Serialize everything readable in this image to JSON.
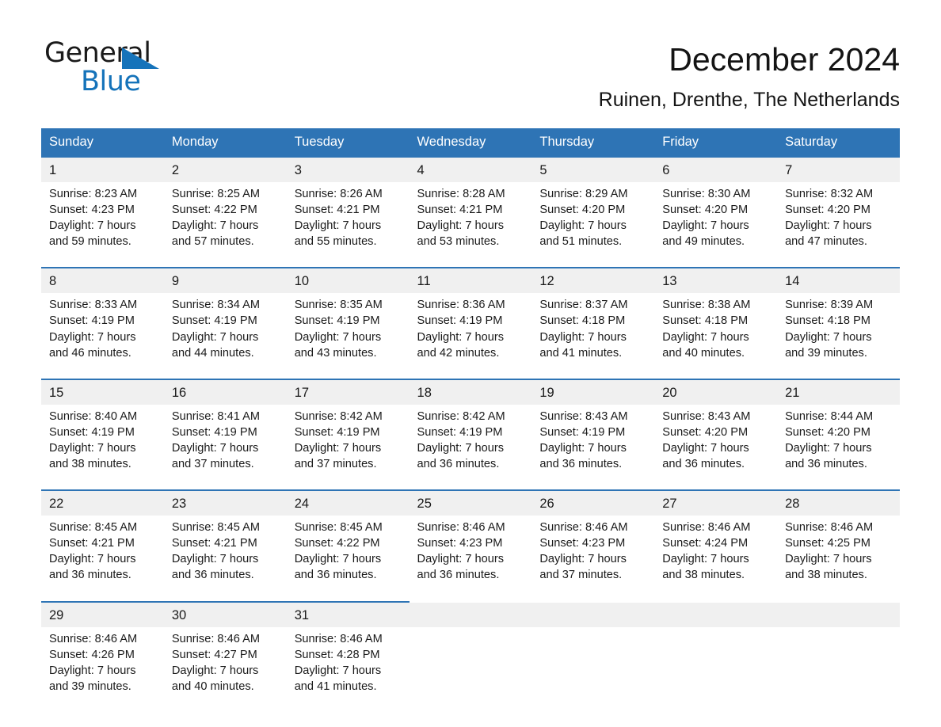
{
  "logo": {
    "word1": "General",
    "word2": "Blue",
    "accent_color": "#1573ba",
    "triangle_icon": "triangle-icon"
  },
  "header": {
    "title": "December 2024",
    "subtitle": "Ruinen, Drenthe, The Netherlands"
  },
  "colors": {
    "header_blue": "#2e74b5",
    "daynum_gray": "#f0f0f0",
    "text": "#1a1a1a",
    "header_text": "#ffffff"
  },
  "weekday_headers": [
    "Sunday",
    "Monday",
    "Tuesday",
    "Wednesday",
    "Thursday",
    "Friday",
    "Saturday"
  ],
  "labels": {
    "sunrise_prefix": "Sunrise:",
    "sunset_prefix": "Sunset:",
    "daylight_prefix": "Daylight:"
  },
  "weeks": [
    [
      {
        "day": "1",
        "sunrise": "Sunrise: 8:23 AM",
        "sunset": "Sunset: 4:23 PM",
        "daylight1": "Daylight: 7 hours",
        "daylight2": "and 59 minutes."
      },
      {
        "day": "2",
        "sunrise": "Sunrise: 8:25 AM",
        "sunset": "Sunset: 4:22 PM",
        "daylight1": "Daylight: 7 hours",
        "daylight2": "and 57 minutes."
      },
      {
        "day": "3",
        "sunrise": "Sunrise: 8:26 AM",
        "sunset": "Sunset: 4:21 PM",
        "daylight1": "Daylight: 7 hours",
        "daylight2": "and 55 minutes."
      },
      {
        "day": "4",
        "sunrise": "Sunrise: 8:28 AM",
        "sunset": "Sunset: 4:21 PM",
        "daylight1": "Daylight: 7 hours",
        "daylight2": "and 53 minutes."
      },
      {
        "day": "5",
        "sunrise": "Sunrise: 8:29 AM",
        "sunset": "Sunset: 4:20 PM",
        "daylight1": "Daylight: 7 hours",
        "daylight2": "and 51 minutes."
      },
      {
        "day": "6",
        "sunrise": "Sunrise: 8:30 AM",
        "sunset": "Sunset: 4:20 PM",
        "daylight1": "Daylight: 7 hours",
        "daylight2": "and 49 minutes."
      },
      {
        "day": "7",
        "sunrise": "Sunrise: 8:32 AM",
        "sunset": "Sunset: 4:20 PM",
        "daylight1": "Daylight: 7 hours",
        "daylight2": "and 47 minutes."
      }
    ],
    [
      {
        "day": "8",
        "sunrise": "Sunrise: 8:33 AM",
        "sunset": "Sunset: 4:19 PM",
        "daylight1": "Daylight: 7 hours",
        "daylight2": "and 46 minutes."
      },
      {
        "day": "9",
        "sunrise": "Sunrise: 8:34 AM",
        "sunset": "Sunset: 4:19 PM",
        "daylight1": "Daylight: 7 hours",
        "daylight2": "and 44 minutes."
      },
      {
        "day": "10",
        "sunrise": "Sunrise: 8:35 AM",
        "sunset": "Sunset: 4:19 PM",
        "daylight1": "Daylight: 7 hours",
        "daylight2": "and 43 minutes."
      },
      {
        "day": "11",
        "sunrise": "Sunrise: 8:36 AM",
        "sunset": "Sunset: 4:19 PM",
        "daylight1": "Daylight: 7 hours",
        "daylight2": "and 42 minutes."
      },
      {
        "day": "12",
        "sunrise": "Sunrise: 8:37 AM",
        "sunset": "Sunset: 4:18 PM",
        "daylight1": "Daylight: 7 hours",
        "daylight2": "and 41 minutes."
      },
      {
        "day": "13",
        "sunrise": "Sunrise: 8:38 AM",
        "sunset": "Sunset: 4:18 PM",
        "daylight1": "Daylight: 7 hours",
        "daylight2": "and 40 minutes."
      },
      {
        "day": "14",
        "sunrise": "Sunrise: 8:39 AM",
        "sunset": "Sunset: 4:18 PM",
        "daylight1": "Daylight: 7 hours",
        "daylight2": "and 39 minutes."
      }
    ],
    [
      {
        "day": "15",
        "sunrise": "Sunrise: 8:40 AM",
        "sunset": "Sunset: 4:19 PM",
        "daylight1": "Daylight: 7 hours",
        "daylight2": "and 38 minutes."
      },
      {
        "day": "16",
        "sunrise": "Sunrise: 8:41 AM",
        "sunset": "Sunset: 4:19 PM",
        "daylight1": "Daylight: 7 hours",
        "daylight2": "and 37 minutes."
      },
      {
        "day": "17",
        "sunrise": "Sunrise: 8:42 AM",
        "sunset": "Sunset: 4:19 PM",
        "daylight1": "Daylight: 7 hours",
        "daylight2": "and 37 minutes."
      },
      {
        "day": "18",
        "sunrise": "Sunrise: 8:42 AM",
        "sunset": "Sunset: 4:19 PM",
        "daylight1": "Daylight: 7 hours",
        "daylight2": "and 36 minutes."
      },
      {
        "day": "19",
        "sunrise": "Sunrise: 8:43 AM",
        "sunset": "Sunset: 4:19 PM",
        "daylight1": "Daylight: 7 hours",
        "daylight2": "and 36 minutes."
      },
      {
        "day": "20",
        "sunrise": "Sunrise: 8:43 AM",
        "sunset": "Sunset: 4:20 PM",
        "daylight1": "Daylight: 7 hours",
        "daylight2": "and 36 minutes."
      },
      {
        "day": "21",
        "sunrise": "Sunrise: 8:44 AM",
        "sunset": "Sunset: 4:20 PM",
        "daylight1": "Daylight: 7 hours",
        "daylight2": "and 36 minutes."
      }
    ],
    [
      {
        "day": "22",
        "sunrise": "Sunrise: 8:45 AM",
        "sunset": "Sunset: 4:21 PM",
        "daylight1": "Daylight: 7 hours",
        "daylight2": "and 36 minutes."
      },
      {
        "day": "23",
        "sunrise": "Sunrise: 8:45 AM",
        "sunset": "Sunset: 4:21 PM",
        "daylight1": "Daylight: 7 hours",
        "daylight2": "and 36 minutes."
      },
      {
        "day": "24",
        "sunrise": "Sunrise: 8:45 AM",
        "sunset": "Sunset: 4:22 PM",
        "daylight1": "Daylight: 7 hours",
        "daylight2": "and 36 minutes."
      },
      {
        "day": "25",
        "sunrise": "Sunrise: 8:46 AM",
        "sunset": "Sunset: 4:23 PM",
        "daylight1": "Daylight: 7 hours",
        "daylight2": "and 36 minutes."
      },
      {
        "day": "26",
        "sunrise": "Sunrise: 8:46 AM",
        "sunset": "Sunset: 4:23 PM",
        "daylight1": "Daylight: 7 hours",
        "daylight2": "and 37 minutes."
      },
      {
        "day": "27",
        "sunrise": "Sunrise: 8:46 AM",
        "sunset": "Sunset: 4:24 PM",
        "daylight1": "Daylight: 7 hours",
        "daylight2": "and 38 minutes."
      },
      {
        "day": "28",
        "sunrise": "Sunrise: 8:46 AM",
        "sunset": "Sunset: 4:25 PM",
        "daylight1": "Daylight: 7 hours",
        "daylight2": "and 38 minutes."
      }
    ],
    [
      {
        "day": "29",
        "sunrise": "Sunrise: 8:46 AM",
        "sunset": "Sunset: 4:26 PM",
        "daylight1": "Daylight: 7 hours",
        "daylight2": "and 39 minutes."
      },
      {
        "day": "30",
        "sunrise": "Sunrise: 8:46 AM",
        "sunset": "Sunset: 4:27 PM",
        "daylight1": "Daylight: 7 hours",
        "daylight2": "and 40 minutes."
      },
      {
        "day": "31",
        "sunrise": "Sunrise: 8:46 AM",
        "sunset": "Sunset: 4:28 PM",
        "daylight1": "Daylight: 7 hours",
        "daylight2": "and 41 minutes."
      },
      {
        "day": "",
        "sunrise": "",
        "sunset": "",
        "daylight1": "",
        "daylight2": ""
      },
      {
        "day": "",
        "sunrise": "",
        "sunset": "",
        "daylight1": "",
        "daylight2": ""
      },
      {
        "day": "",
        "sunrise": "",
        "sunset": "",
        "daylight1": "",
        "daylight2": ""
      },
      {
        "day": "",
        "sunrise": "",
        "sunset": "",
        "daylight1": "",
        "daylight2": ""
      }
    ]
  ]
}
